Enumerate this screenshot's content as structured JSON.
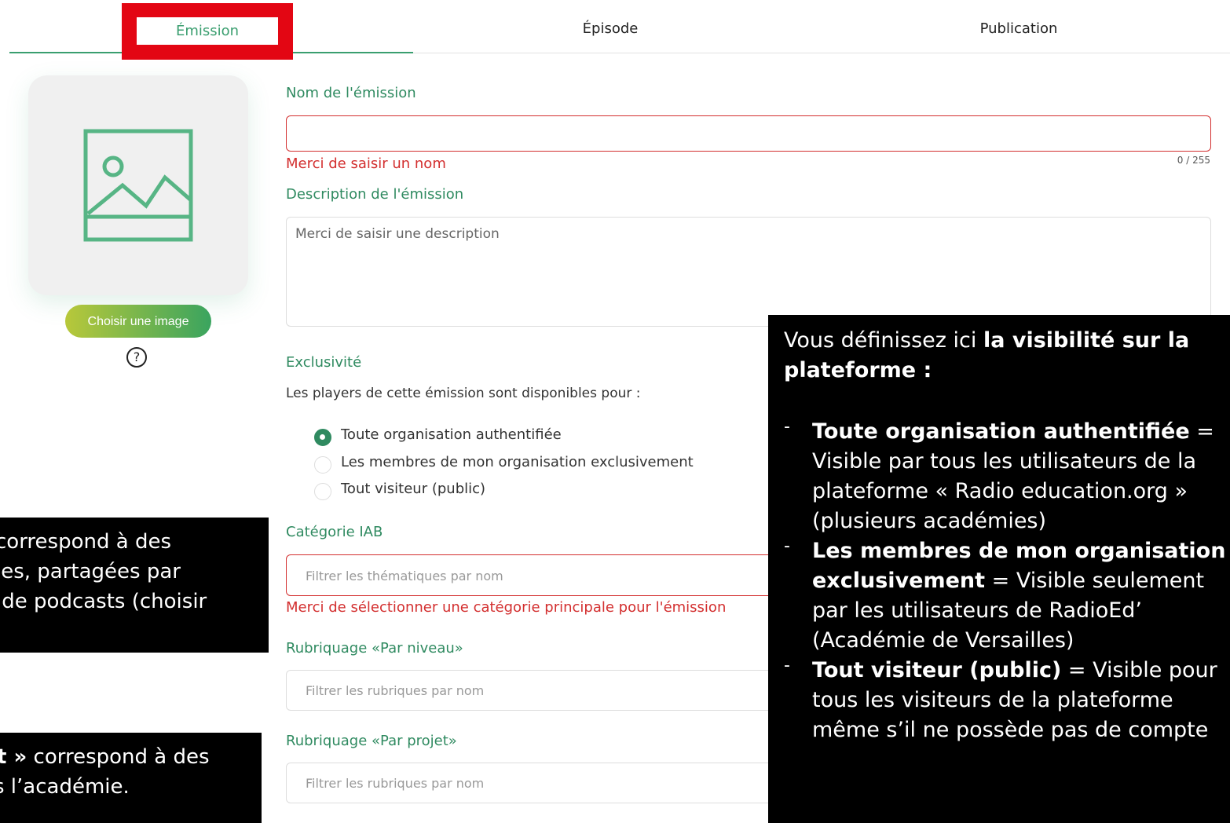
{
  "tabs": [
    {
      "label": "Émission"
    },
    {
      "label": "Épisode"
    },
    {
      "label": "Publication"
    }
  ],
  "image": {
    "button_label": "Choisir une image",
    "help_icon": "question-circle-icon"
  },
  "form": {
    "name": {
      "label": "Nom de l'émission",
      "value": "",
      "counter": "0 / 255",
      "error": "Merci de saisir un nom"
    },
    "description": {
      "label": "Description de l'émission",
      "placeholder": "Merci de saisir une description"
    },
    "exclusivity": {
      "label": "Exclusivité",
      "intro": "Les players de cette émission sont disponibles pour :",
      "options": [
        {
          "label": "Toute organisation authentifiée",
          "selected": true
        },
        {
          "label": "Les membres de mon organisation exclusivement",
          "selected": false
        },
        {
          "label": "Tout visiteur (public)",
          "selected": false
        }
      ]
    },
    "iab": {
      "label": "Catégorie IAB",
      "placeholder": "Filtrer les thématiques par nom",
      "error": "Merci de sélectionner une catégorie principale pour l'émission"
    },
    "level": {
      "label": "Rubriquage «Par niveau»",
      "placeholder": "Filtrer les rubriques par nom"
    },
    "project": {
      "label": "Rubriquage «Par projet»",
      "placeholder": "Filtrer les rubriques par nom"
    }
  },
  "overlay_left_1": {
    "lines": [
      "correspond à des",
      "les, partagées par",
      " de podcasts (choisir"
    ]
  },
  "overlay_left_2": {
    "bold": "t »",
    "line1": " correspond à des",
    "line2": "s l’académie."
  },
  "overlay_right": {
    "intro": "Vous définissez ici ",
    "intro_bold": "la visibilité sur la plateforme :",
    "items": [
      {
        "bold": "Toute organisation authentifiée",
        "text": " = Visible par tous les utilisateurs de la plateforme « Radio education.org » (plusieurs académies)"
      },
      {
        "bold": "Les membres de mon organisation exclusivement",
        "text": " = Visible seulement par les utilisateurs de RadioEd’ (Académie de Versailles)"
      },
      {
        "bold": "Tout visiteur (public)",
        "text": " = Visible pour tous les visiteurs de la plateforme même s’il ne possède pas de compte"
      }
    ]
  },
  "colors": {
    "accent": "#3a9e6f",
    "error": "#d32f2f",
    "highlight": "#e30613"
  }
}
